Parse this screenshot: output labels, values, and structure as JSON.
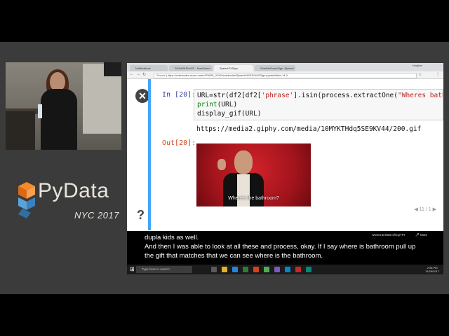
{
  "logo": {
    "brand": "PyData",
    "event": "NYC 2017"
  },
  "browser": {
    "tabs": [
      "Notifications",
      "SGHASHProSZ - NowDemo..",
      "SpeechToSign",
      "GiveMeSomeSign: Speech T"
    ],
    "user": "Heather",
    "secure_label": "Secure",
    "url": "https://notebooks.azure.com/r/PM/lSl_JGk2/notebooks/Speech%20To%20Sign.ipynb#/slide-14-0"
  },
  "notebook": {
    "in_prompt": "In [20]:",
    "out_prompt": "Out[20]:",
    "code": {
      "line1_prefix": "URL=str(df2[df2[",
      "line1_str1": "'phrase'",
      "line1_mid": "].isin(process.extractOne(",
      "line1_str2": "\"Wheres bathroom",
      "line2_fn": "print",
      "line2_rest": "(URL)",
      "line3": "display_gif(URL)"
    },
    "output_url": "https://media2.giphy.com/media/10MYKTHdq5SE9KV44/200.gif",
    "gif_caption": "Where's the bathroom?",
    "pager": "11 / 1"
  },
  "captions": {
    "partial_line": "dupla kids as well.",
    "main_line": "And then I was able to look at all these and process, okay. If I say where is bathroom pull up the gift that matches that we can see where is the bathroom.",
    "translate_url": "www.translate.it/GQTPI",
    "mute_label": "Mute"
  },
  "taskbar": {
    "search_placeholder": "Type here to search",
    "time": "2:08 PM",
    "date": "11/28/2017"
  },
  "colors": {
    "accent_blue": "#42a5f5",
    "gif_red": "#c8161f"
  }
}
